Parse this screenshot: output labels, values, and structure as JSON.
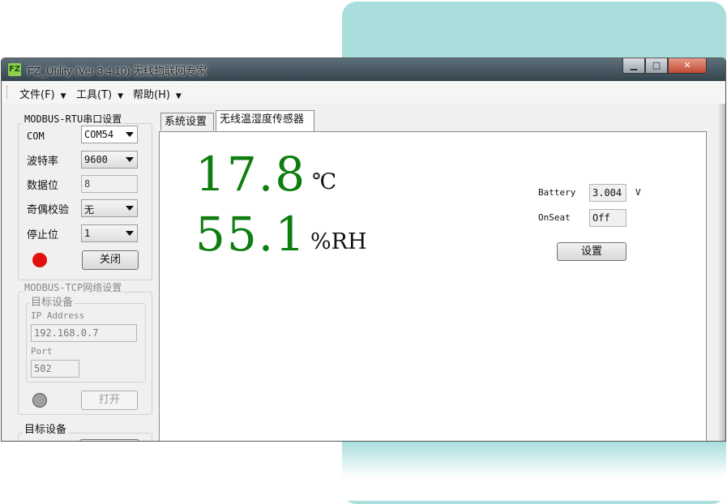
{
  "window": {
    "icon_text": "FZ",
    "title": "FZ_Utility (Ver 3.4.10) 无线物联网专家",
    "minimize": "▁",
    "maximize": "□",
    "close": "✕"
  },
  "menu": [
    {
      "label": "文件(F)"
    },
    {
      "label": "工具(T)"
    },
    {
      "label": "帮助(H)"
    }
  ],
  "rtu": {
    "title": "MODBUS-RTU串口设置",
    "com_label": "COM",
    "com_value": "COM54",
    "baud_label": "波特率",
    "baud_value": "9600",
    "databits_label": "数据位",
    "databits_value": "8",
    "parity_label": "奇偶校验",
    "parity_value": "无",
    "stopbits_label": "停止位",
    "stopbits_value": "1",
    "status_color": "#e41010",
    "button_label": "关闭"
  },
  "tcp": {
    "title": "MODBUS-TCP网络设置",
    "target_title": "目标设备",
    "ip_label": "IP Address",
    "ip_value": "192.168.0.7",
    "port_label": "Port",
    "port_value": "502",
    "status_color": "#a0a0a0",
    "button_label": "打开"
  },
  "target2": {
    "title": "目标设备"
  },
  "tabs": [
    {
      "label": "系统设置",
      "active": false
    },
    {
      "label": "无线温湿度传感器",
      "active": true
    }
  ],
  "sensor": {
    "temperature": "17.8",
    "temperature_unit": "℃",
    "humidity": "55.1",
    "humidity_unit": "%RH",
    "battery_label": "Battery",
    "battery_value": "3.004",
    "battery_unit": "V",
    "onseat_label": "OnSeat",
    "onseat_value": "Off",
    "settings_button": "设置",
    "value_color": "#0e7d0e"
  }
}
